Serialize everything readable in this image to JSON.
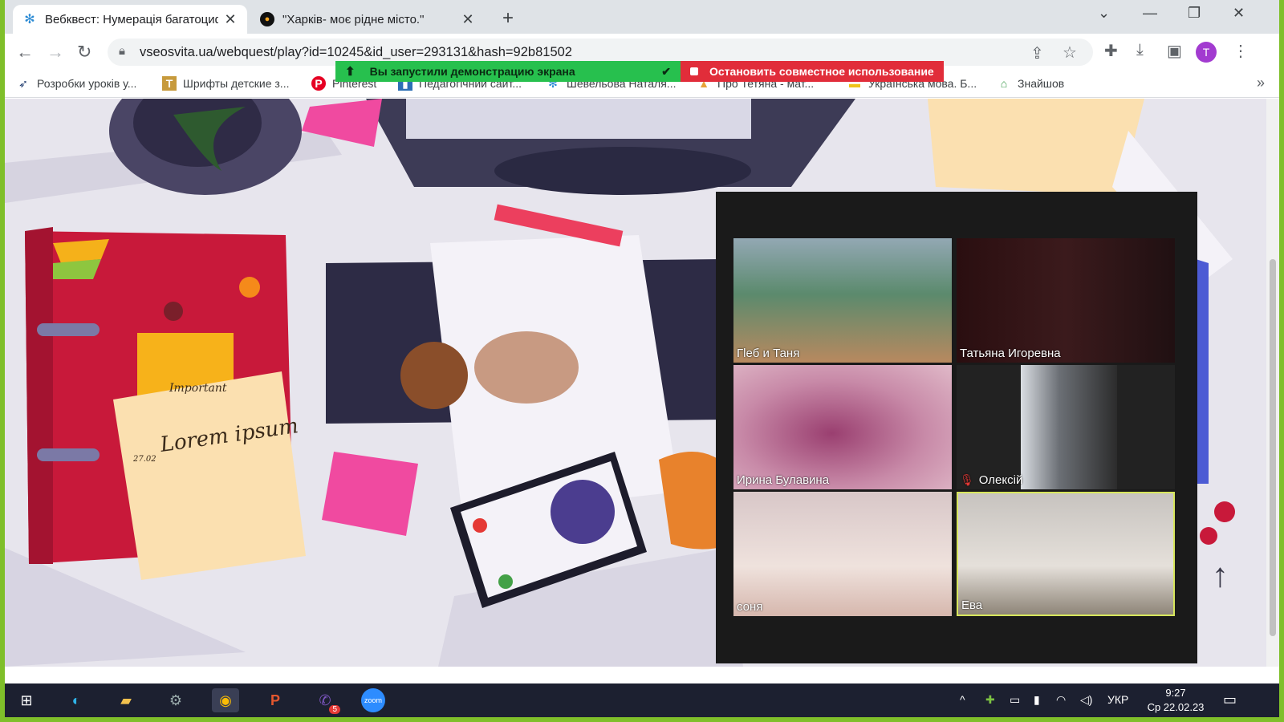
{
  "browser": {
    "tabs": [
      {
        "title": "Вебквест: Нумерація багатоциф",
        "active": true,
        "icon": "snowflake-icon"
      },
      {
        "title": "\"Харків- моє рідне місто.\"",
        "active": false,
        "icon": "site-favicon"
      }
    ],
    "url": "vseosvita.ua/webquest/play?id=10245&id_user=293131&hash=92b81502",
    "profile_initial": "T",
    "bookmarks": [
      {
        "label": "Розробки уроків у...",
        "icon": "bird-icon"
      },
      {
        "label": "Шрифты детские з...",
        "icon": "font-icon"
      },
      {
        "label": "Pinterest",
        "icon": "pinterest-icon"
      },
      {
        "label": "Педагогічний сайт...",
        "icon": "chart-icon"
      },
      {
        "label": "Шевельова Наталя...",
        "icon": "snowflake-icon"
      },
      {
        "label": "Про Тетяна - мат...",
        "icon": "person-icon"
      },
      {
        "label": "Українська мова. Б...",
        "icon": "book-icon"
      },
      {
        "label": "Знайшов",
        "icon": "found-icon"
      }
    ]
  },
  "share_banner": {
    "status": "Вы запустили демонстрацию экрана",
    "stop": "Остановить совместное использование"
  },
  "zoom": {
    "participants": [
      {
        "name": "Гleб и Таня",
        "muted": false,
        "speaking": false
      },
      {
        "name": "Татьяна Игоревна",
        "muted": false,
        "speaking": false
      },
      {
        "name": "Ирина Булавина",
        "muted": false,
        "speaking": false
      },
      {
        "name": "Олексій",
        "muted": true,
        "speaking": false
      },
      {
        "name": "соня",
        "muted": false,
        "speaking": false
      },
      {
        "name": "Ева",
        "muted": false,
        "speaking": true
      }
    ]
  },
  "illustration": {
    "note_heading": "Important",
    "note_title": "Lorem ipsum",
    "note_date": "27.02"
  },
  "taskbar": {
    "apps": [
      "windows-start",
      "edge",
      "file-explorer",
      "settings",
      "chrome",
      "powerpoint",
      "viber",
      "zoom"
    ],
    "viber_badge": "5",
    "zoom_label": "zoom",
    "language": "УКР",
    "time": "9:27",
    "date": "Ср 22.02.23"
  },
  "colors": {
    "frame": "#7fbf2a",
    "share_green": "#27c04e",
    "share_red": "#e12d3a",
    "speaking_border": "#d7e65c"
  }
}
